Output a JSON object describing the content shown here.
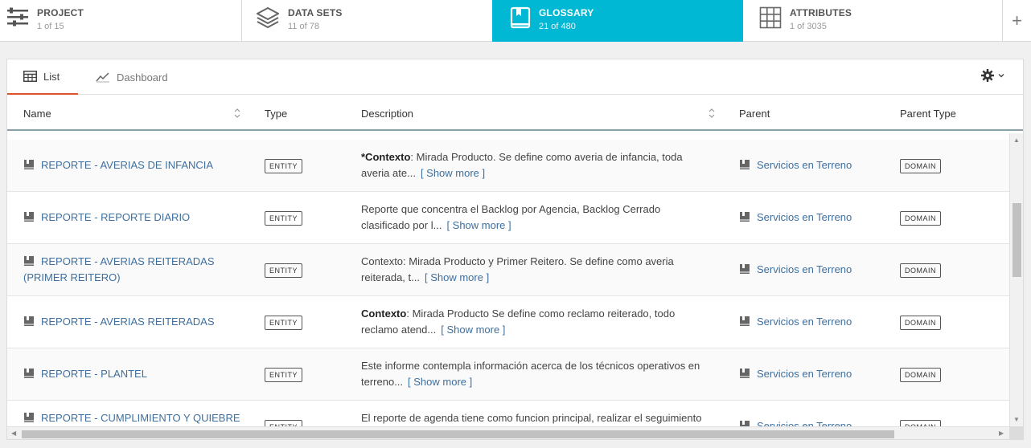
{
  "nav": {
    "tabs": [
      {
        "title": "PROJECT",
        "sub": "1 of 15"
      },
      {
        "title": "DATA SETS",
        "sub": "11 of 78"
      },
      {
        "title": "GLOSSARY",
        "sub": "21 of 480"
      },
      {
        "title": "ATTRIBUTES",
        "sub": "1 of 3035"
      }
    ],
    "add_label": "+"
  },
  "views": {
    "list_label": "List",
    "dashboard_label": "Dashboard"
  },
  "columns": {
    "name": "Name",
    "type": "Type",
    "description": "Description",
    "parent": "Parent",
    "parent_type": "Parent Type"
  },
  "show_more": "[ Show more ]",
  "rows": [
    {
      "name_line1": "REPORTE - AVERIAS DE INFANCIA",
      "name_line2": "",
      "type": "ENTITY",
      "desc_bold": "*Contexto",
      "desc_line1": ": Mirada Producto.  Se define como averia de infancia, toda",
      "desc_line2": "averia ate...",
      "parent": "Servicios en Terreno",
      "parent_type": "DOMAIN"
    },
    {
      "name_line1": "REPORTE - REPORTE DIARIO",
      "name_line2": "",
      "type": "ENTITY",
      "desc_bold": "",
      "desc_line1": "Reporte que concentra el Backlog por Agencia, Backlog Cerrado",
      "desc_line2": "clasificado por l...",
      "parent": "Servicios en Terreno",
      "parent_type": "DOMAIN"
    },
    {
      "name_line1": "REPORTE - AVERIAS REITERADAS",
      "name_line2": "(PRIMER REITERO)",
      "type": "ENTITY",
      "desc_bold": "",
      "desc_line1": "Contexto: Mirada Producto y Primer Reitero. Se define como averia",
      "desc_line2": "reiterada, t...",
      "parent": "Servicios en Terreno",
      "parent_type": "DOMAIN"
    },
    {
      "name_line1": "REPORTE - AVERIAS REITERADAS",
      "name_line2": "",
      "type": "ENTITY",
      "desc_bold": "Contexto",
      "desc_line1": ": Mirada Producto Se define como reclamo reiterado, todo",
      "desc_line2": "reclamo atend...",
      "parent": "Servicios en Terreno",
      "parent_type": "DOMAIN"
    },
    {
      "name_line1": "REPORTE - PLANTEL",
      "name_line2": "",
      "type": "ENTITY",
      "desc_bold": "",
      "desc_line1": "Este informe contempla información acerca de los técnicos operativos en",
      "desc_line2": "terreno...",
      "parent": "Servicios en Terreno",
      "parent_type": "DOMAIN"
    },
    {
      "name_line1": "REPORTE - CUMPLIMIENTO Y QUIEBRE",
      "name_line2": "",
      "type": "ENTITY",
      "desc_bold": "",
      "desc_line1": "El reporte de agenda tiene como funcion principal, realizar el seguimiento",
      "desc_line2": "",
      "parent": "Servicios en Terreno",
      "parent_type": "DOMAIN"
    }
  ],
  "colors": {
    "accent": "#00b8d4",
    "link": "#3e6f9e",
    "tab_underline": "#e0522a"
  }
}
